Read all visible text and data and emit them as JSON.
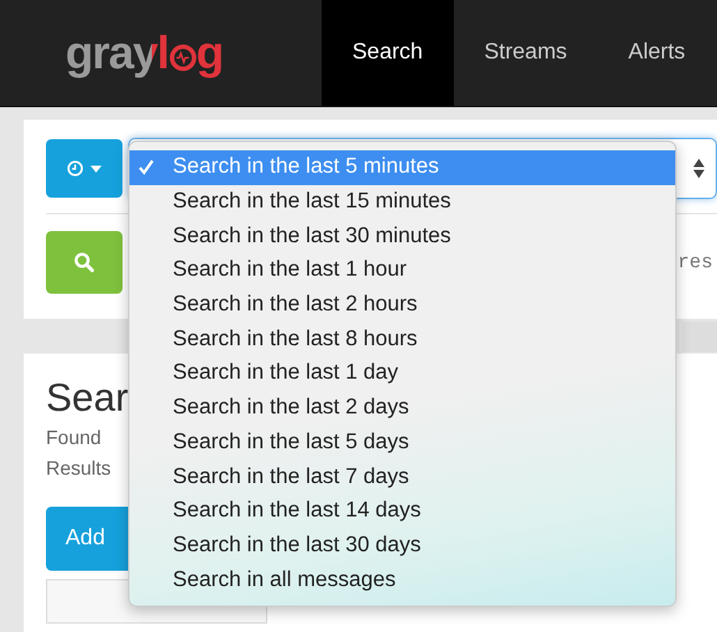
{
  "navbar": {
    "logo": {
      "text_start": "grayl",
      "text_end": "g"
    },
    "items": [
      {
        "label": "Search",
        "selected": true
      },
      {
        "label": "Streams",
        "selected": false
      },
      {
        "label": "Alerts",
        "selected": false
      }
    ]
  },
  "search_panel": {
    "query_placeholder": "res"
  },
  "results_panel": {
    "title": "Sear",
    "found_text": "Found",
    "results_text": "Results",
    "add_button": "Add"
  },
  "time_range_menu": {
    "options": [
      {
        "label": "Search in the last 5 minutes",
        "selected": true
      },
      {
        "label": "Search in the last 15 minutes",
        "selected": false
      },
      {
        "label": "Search in the last 30 minutes",
        "selected": false
      },
      {
        "label": "Search in the last 1 hour",
        "selected": false
      },
      {
        "label": "Search in the last 2 hours",
        "selected": false
      },
      {
        "label": "Search in the last 8 hours",
        "selected": false
      },
      {
        "label": "Search in the last 1 day",
        "selected": false
      },
      {
        "label": "Search in the last 2 days",
        "selected": false
      },
      {
        "label": "Search in the last 5 days",
        "selected": false
      },
      {
        "label": "Search in the last 7 days",
        "selected": false
      },
      {
        "label": "Search in the last 14 days",
        "selected": false
      },
      {
        "label": "Search in the last 30 days",
        "selected": false
      },
      {
        "label": "Search in all messages",
        "selected": false
      }
    ]
  }
}
